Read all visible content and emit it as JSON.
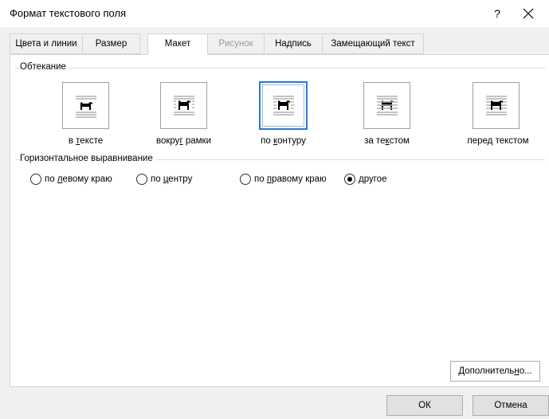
{
  "window": {
    "title": "Формат текстового поля",
    "help": "?",
    "close_icon": "close-icon"
  },
  "tabs": [
    {
      "label": "Цвета и линии",
      "state": "normal"
    },
    {
      "label": "Размер",
      "state": "normal"
    },
    {
      "label": "Макет",
      "state": "active"
    },
    {
      "label": "Рисунок",
      "state": "disabled"
    },
    {
      "label": "Надпись",
      "state": "normal"
    },
    {
      "label": "Замещающий текст",
      "state": "normal"
    }
  ],
  "wrapping": {
    "group_label": "Обтекание",
    "options": [
      {
        "label": "в тексте",
        "icon": "inline-wrap-icon",
        "selected": false
      },
      {
        "label": "вокруг рамки",
        "icon": "square-wrap-icon",
        "selected": false
      },
      {
        "label": "по контуру",
        "icon": "tight-wrap-icon",
        "selected": true
      },
      {
        "label": "за текстом",
        "icon": "behind-text-icon",
        "selected": false
      },
      {
        "label": "перед текстом",
        "icon": "in-front-text-icon",
        "selected": false
      }
    ]
  },
  "alignment": {
    "group_label": "Горизонтальное выравнивание",
    "options": [
      {
        "label": "по левому краю",
        "checked": false
      },
      {
        "label": "по центру",
        "checked": false
      },
      {
        "label": "по правому краю",
        "checked": false
      },
      {
        "label": "другое",
        "checked": true
      }
    ]
  },
  "buttons": {
    "advanced": "Дополнительно...",
    "ok": "ОК",
    "cancel": "Отмена"
  },
  "colors": {
    "selection": "#2b79d0",
    "background": "#f0f0f0",
    "panel": "#ffffff"
  }
}
